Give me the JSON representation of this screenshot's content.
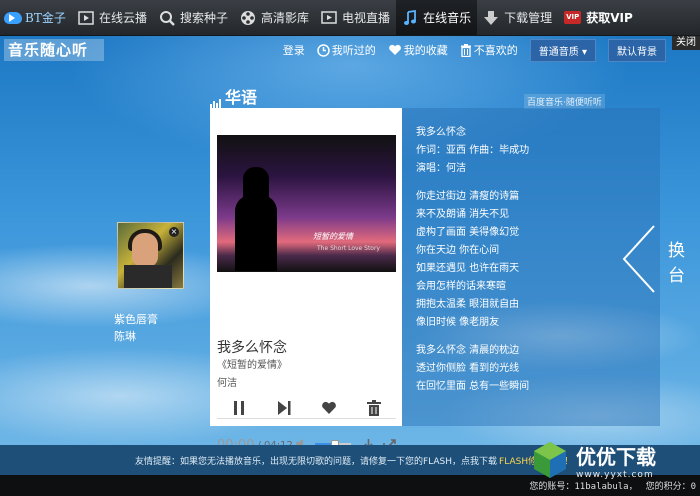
{
  "app": {
    "logo_text": "BT金子"
  },
  "nav": [
    {
      "label": "在线云播",
      "icon": "play-box-icon"
    },
    {
      "label": "搜索种子",
      "icon": "search-icon"
    },
    {
      "label": "高清影库",
      "icon": "film-reel-icon"
    },
    {
      "label": "电视直播",
      "icon": "tv-play-icon"
    },
    {
      "label": "在线音乐",
      "icon": "music-note-icon"
    },
    {
      "label": "下载管理",
      "icon": "download-arrow-icon"
    },
    {
      "label": "获取VIP",
      "icon": "vip-badge-icon",
      "badge": "VIP"
    }
  ],
  "music": {
    "brand": "音乐随心听",
    "close_label": "关闭",
    "toolbar": {
      "login": "登录",
      "history": "我听过的",
      "favorites": "我的收藏",
      "dislike": "不喜欢的",
      "quality": "普通音质",
      "background": "默认背景"
    },
    "channel": "华语",
    "watermark": "百度音乐·随便听听",
    "previous": {
      "title": "紫色唇膏",
      "artist": "陈琳"
    },
    "current": {
      "song": "我多么怀念",
      "album": "《短暂的爱情》",
      "artist": "何洁",
      "cover_text": "短暂的爱情",
      "cover_subtext": "The Short Love Story",
      "time_current": "00:00",
      "time_total": "/ 04:12",
      "volume_percent": 55
    },
    "lyrics": [
      [
        "我多么怀念",
        "作词：亚西 作曲：毕成功",
        "演唱：何洁"
      ],
      [
        "你走过街边 清瘦的诗篇",
        "来不及朗诵 消失不见",
        "虚构了画面 美得像幻觉",
        "你在天边 你在心间",
        "如果还遇见 也许在雨天",
        "会用怎样的话来寒暄",
        "拥抱太温柔 眼泪就自由",
        "像旧时候 像老朋友"
      ],
      [
        "我多么怀念 清晨的枕边",
        "透过你侧脸 看到的光线",
        "在回忆里面 总有一些瞬间"
      ]
    ],
    "next_label": "换台"
  },
  "notice": {
    "text": "友情提醒：如果您无法播放音乐，出现无限切歌的问题，请修复一下您的FLASH，点我下载",
    "link": "FLASH修复工具！"
  },
  "status": {
    "account": "您的账号：11balabula，",
    "points": "您的积分：0"
  },
  "site_watermark": {
    "name": "优优下载",
    "url": "www.yyxt.com"
  },
  "colors": {
    "topbar": "#2a2e33",
    "accent_blue": "#3a8ee6",
    "notice_link": "#ffd54a"
  }
}
